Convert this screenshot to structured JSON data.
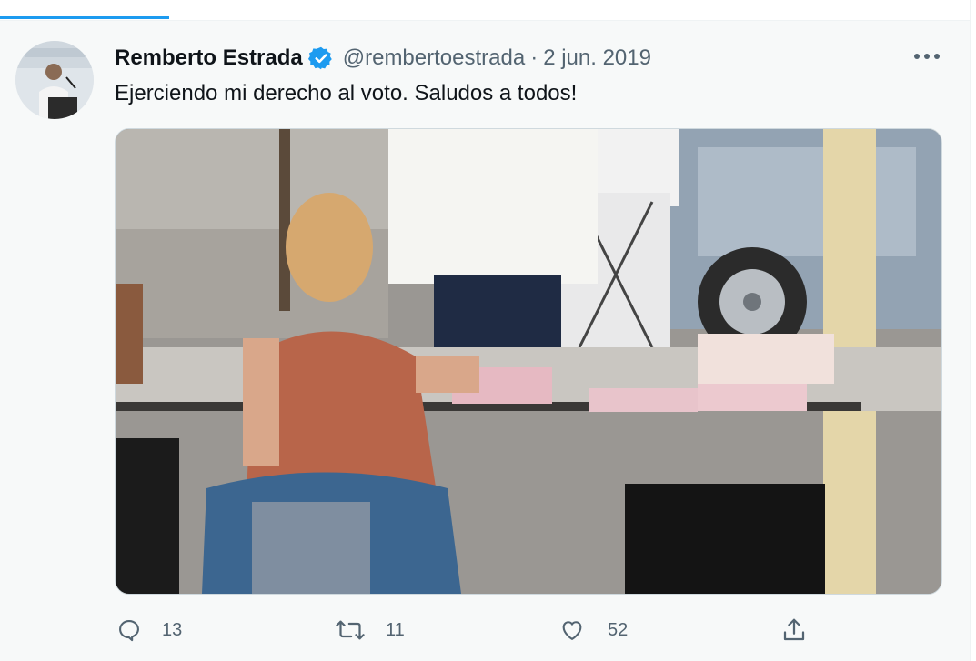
{
  "tweet": {
    "display_name": "Remberto Estrada",
    "handle": "@rembertoestrada",
    "separator": "·",
    "date": "2 jun. 2019",
    "text": "Ejerciendo mi derecho al voto. Saludos a todos!"
  },
  "actions": {
    "reply_count": "13",
    "retweet_count": "11",
    "like_count": "52"
  },
  "icons": {
    "verified": "verified-badge-icon",
    "more": "more-options-icon",
    "reply": "reply-icon",
    "retweet": "retweet-icon",
    "like": "heart-icon",
    "share": "share-icon"
  },
  "colors": {
    "accent": "#1d9bf0",
    "text_primary": "#0f1419",
    "text_secondary": "#536471"
  }
}
